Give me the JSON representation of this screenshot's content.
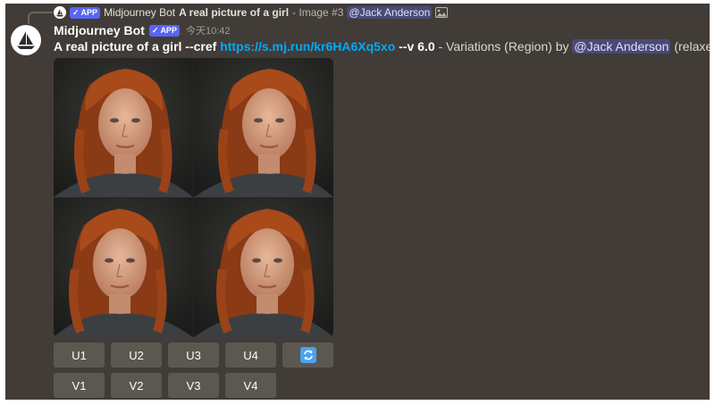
{
  "reply": {
    "badge": "APP",
    "author": "Midjourney Bot",
    "text": "A real picture of a girl",
    "suffix": " - Image #3",
    "mention": "@Jack Anderson"
  },
  "message": {
    "username": "Midjourney Bot",
    "badge": "APP",
    "timestamp": "今天10:42",
    "prompt": "A real picture of a girl --cref",
    "link": "https://s.mj.run/kr6HA6Xq5xo",
    "version": "--v 6.0",
    "desc": " - Variations (Region) by ",
    "mention": "@Jack Anderson",
    "mode": "(relaxed)"
  },
  "images": [
    {
      "name": "image-1"
    },
    {
      "name": "image-2"
    },
    {
      "name": "image-3"
    },
    {
      "name": "image-4"
    }
  ],
  "buttons_upscale": [
    "U1",
    "U2",
    "U3",
    "U4"
  ],
  "buttons_variation": [
    "V1",
    "V2",
    "V3",
    "V4"
  ],
  "icons": {
    "reroll": "refresh-icon",
    "bot_avatar": "sailboat-logo-icon",
    "attachment": "image-icon"
  },
  "colors": {
    "background": "#413c37",
    "button": "#5b5751",
    "reroll_icon": "#4aa3f0",
    "link": "#00aafc",
    "app_badge": "#5865f2"
  }
}
